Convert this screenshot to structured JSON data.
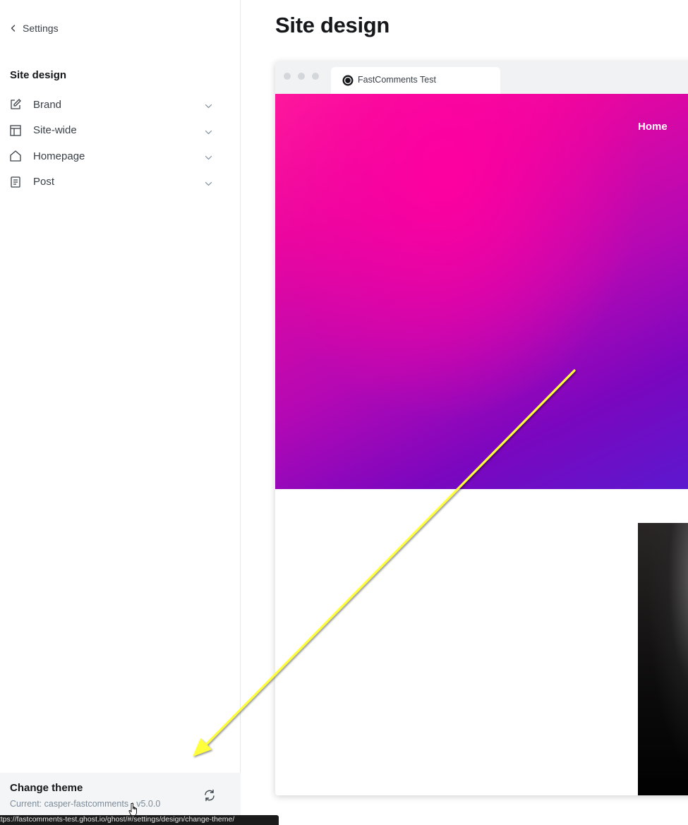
{
  "sidebar": {
    "back_label": "Settings",
    "section_title": "Site design",
    "items": [
      {
        "label": "Brand",
        "icon": "pencil-square-icon"
      },
      {
        "label": "Site-wide",
        "icon": "layout-icon"
      },
      {
        "label": "Homepage",
        "icon": "home-icon"
      },
      {
        "label": "Post",
        "icon": "document-icon"
      }
    ],
    "change_theme": {
      "title": "Change theme",
      "current": "Current: casper-fastcomments - v5.0.0"
    }
  },
  "tooltip": "https://fastcomments-test.ghost.io/ghost/#/settings/design/change-theme/",
  "main": {
    "title": "Site design",
    "preview": {
      "tab_title": "FastComments Test",
      "nav_link": "Home"
    }
  },
  "colors": {
    "annotation_arrow": "#ffff3a",
    "hero_gradient_top": "#ff1a9c",
    "hero_gradient_bottom": "#5a19cf"
  }
}
